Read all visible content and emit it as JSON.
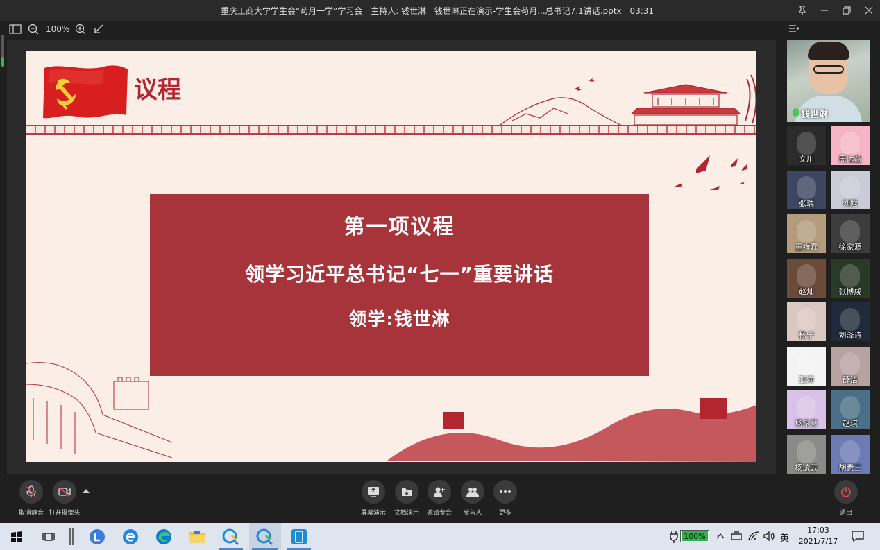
{
  "titlebar": {
    "meeting_title": "重庆工商大学学生会“苟月一学”学习会",
    "host": "主持人: 钱世淋",
    "sharing": "钱世淋正在演示-学生会苟月...总书记7.1讲话.pptx",
    "timer": "03:31"
  },
  "toolbar": {
    "zoom": "100%"
  },
  "slide": {
    "title": "议程",
    "agenda_heading": "第一项议程",
    "agenda_topic": "领学习近平总书记“七一”重要讲话",
    "agenda_leader": "领学:钱世淋"
  },
  "host": {
    "name": "钱世淋"
  },
  "participants": [
    {
      "name": "文川",
      "color": "#2b2b2b"
    },
    {
      "name": "周远益",
      "color": "#f4b6c4"
    },
    {
      "name": "张瑞",
      "color": "#3b4662"
    },
    {
      "name": "刘晗",
      "color": "#c9cbd6"
    },
    {
      "name": "王祥霖",
      "color": "#b39b7d"
    },
    {
      "name": "徐家源",
      "color": "#3c3c3c"
    },
    {
      "name": "赵灿",
      "color": "#6b4a3a"
    },
    {
      "name": "张博成",
      "color": "#2a3a28"
    },
    {
      "name": "杨宁",
      "color": "#d9c7c2"
    },
    {
      "name": "刘泽诗",
      "color": "#1f2a3a"
    },
    {
      "name": "张洋",
      "color": "#f3f3f3"
    },
    {
      "name": "薛洁",
      "color": "#b6a2a0"
    },
    {
      "name": "杨家意",
      "color": "#d8c2e8"
    },
    {
      "name": "赵琪",
      "color": "#4a6f86"
    },
    {
      "name": "杨凌云",
      "color": "#8a8a86"
    },
    {
      "name": "胡贵三",
      "color": "#6c7bb3"
    }
  ],
  "controls": {
    "unmute": "取消静音",
    "camera": "打开摄像头",
    "screen_share": "屏幕演示",
    "doc_share": "文档演示",
    "invite": "邀请参会",
    "attendees": "参与人",
    "more": "更多",
    "exit": "退出"
  },
  "taskbar": {
    "battery": "100%",
    "battery_level": 1.0,
    "ime": "英",
    "time": "17:03",
    "date": "2021/7/17"
  }
}
